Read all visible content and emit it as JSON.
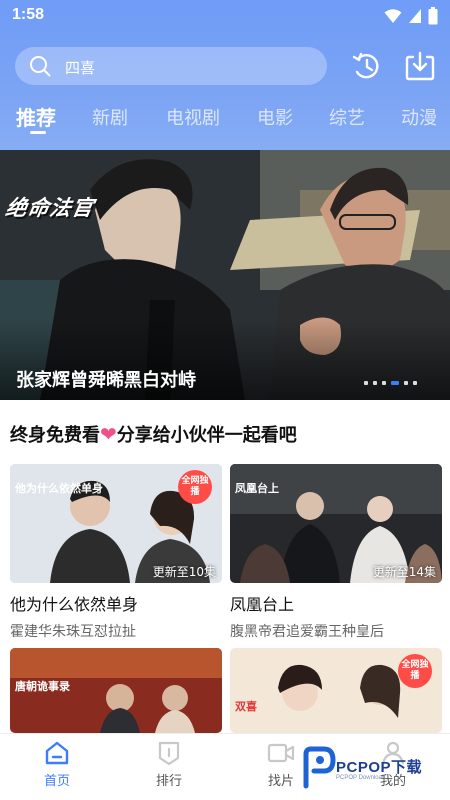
{
  "status_bar": {
    "time": "1:58"
  },
  "search": {
    "text": "四喜"
  },
  "tabs": [
    {
      "label": "推荐"
    },
    {
      "label": "新剧"
    },
    {
      "label": "电视剧"
    },
    {
      "label": "电影"
    },
    {
      "label": "综艺"
    },
    {
      "label": "动漫"
    }
  ],
  "banner": {
    "logo_text": "绝命法官",
    "caption": "张家辉曾舜晞黑白对峙",
    "dot_count": 6,
    "active_dot": 3
  },
  "promo": {
    "before_heart": "终身免费看",
    "after_heart": "分享给小伙伴一起看吧"
  },
  "cards": [
    {
      "title": "他为什么依然单身",
      "subtitle": "霍建华朱珠互怼拉扯",
      "update": "更新至10集",
      "badge": "全网独播",
      "thumb_text": "他为什么依然单身"
    },
    {
      "title": "凤凰台上",
      "subtitle": "腹黑帝君追爱霸王种皇后",
      "update": "更新至14集",
      "badge": "",
      "thumb_text": "凤凰台上"
    },
    {
      "title": "",
      "subtitle": "",
      "update": "",
      "badge": "",
      "thumb_text": "唐朝诡事录"
    },
    {
      "title": "",
      "subtitle": "",
      "update": "",
      "badge": "全网独播",
      "thumb_text": "双喜"
    }
  ],
  "bottom_nav": [
    {
      "label": "首页",
      "icon": "home-icon"
    },
    {
      "label": "排行",
      "icon": "ranking-icon"
    },
    {
      "label": "找片",
      "icon": "video-camera-icon"
    },
    {
      "label": "我的",
      "icon": "user-icon"
    }
  ],
  "watermark": {
    "brand": "PCPOP下载",
    "sub": "PCPOP Download"
  },
  "colors": {
    "accent": "#3d7bff",
    "header": "#7aa3f5",
    "badge": "#ff4c47",
    "heart": "#f0508a"
  }
}
